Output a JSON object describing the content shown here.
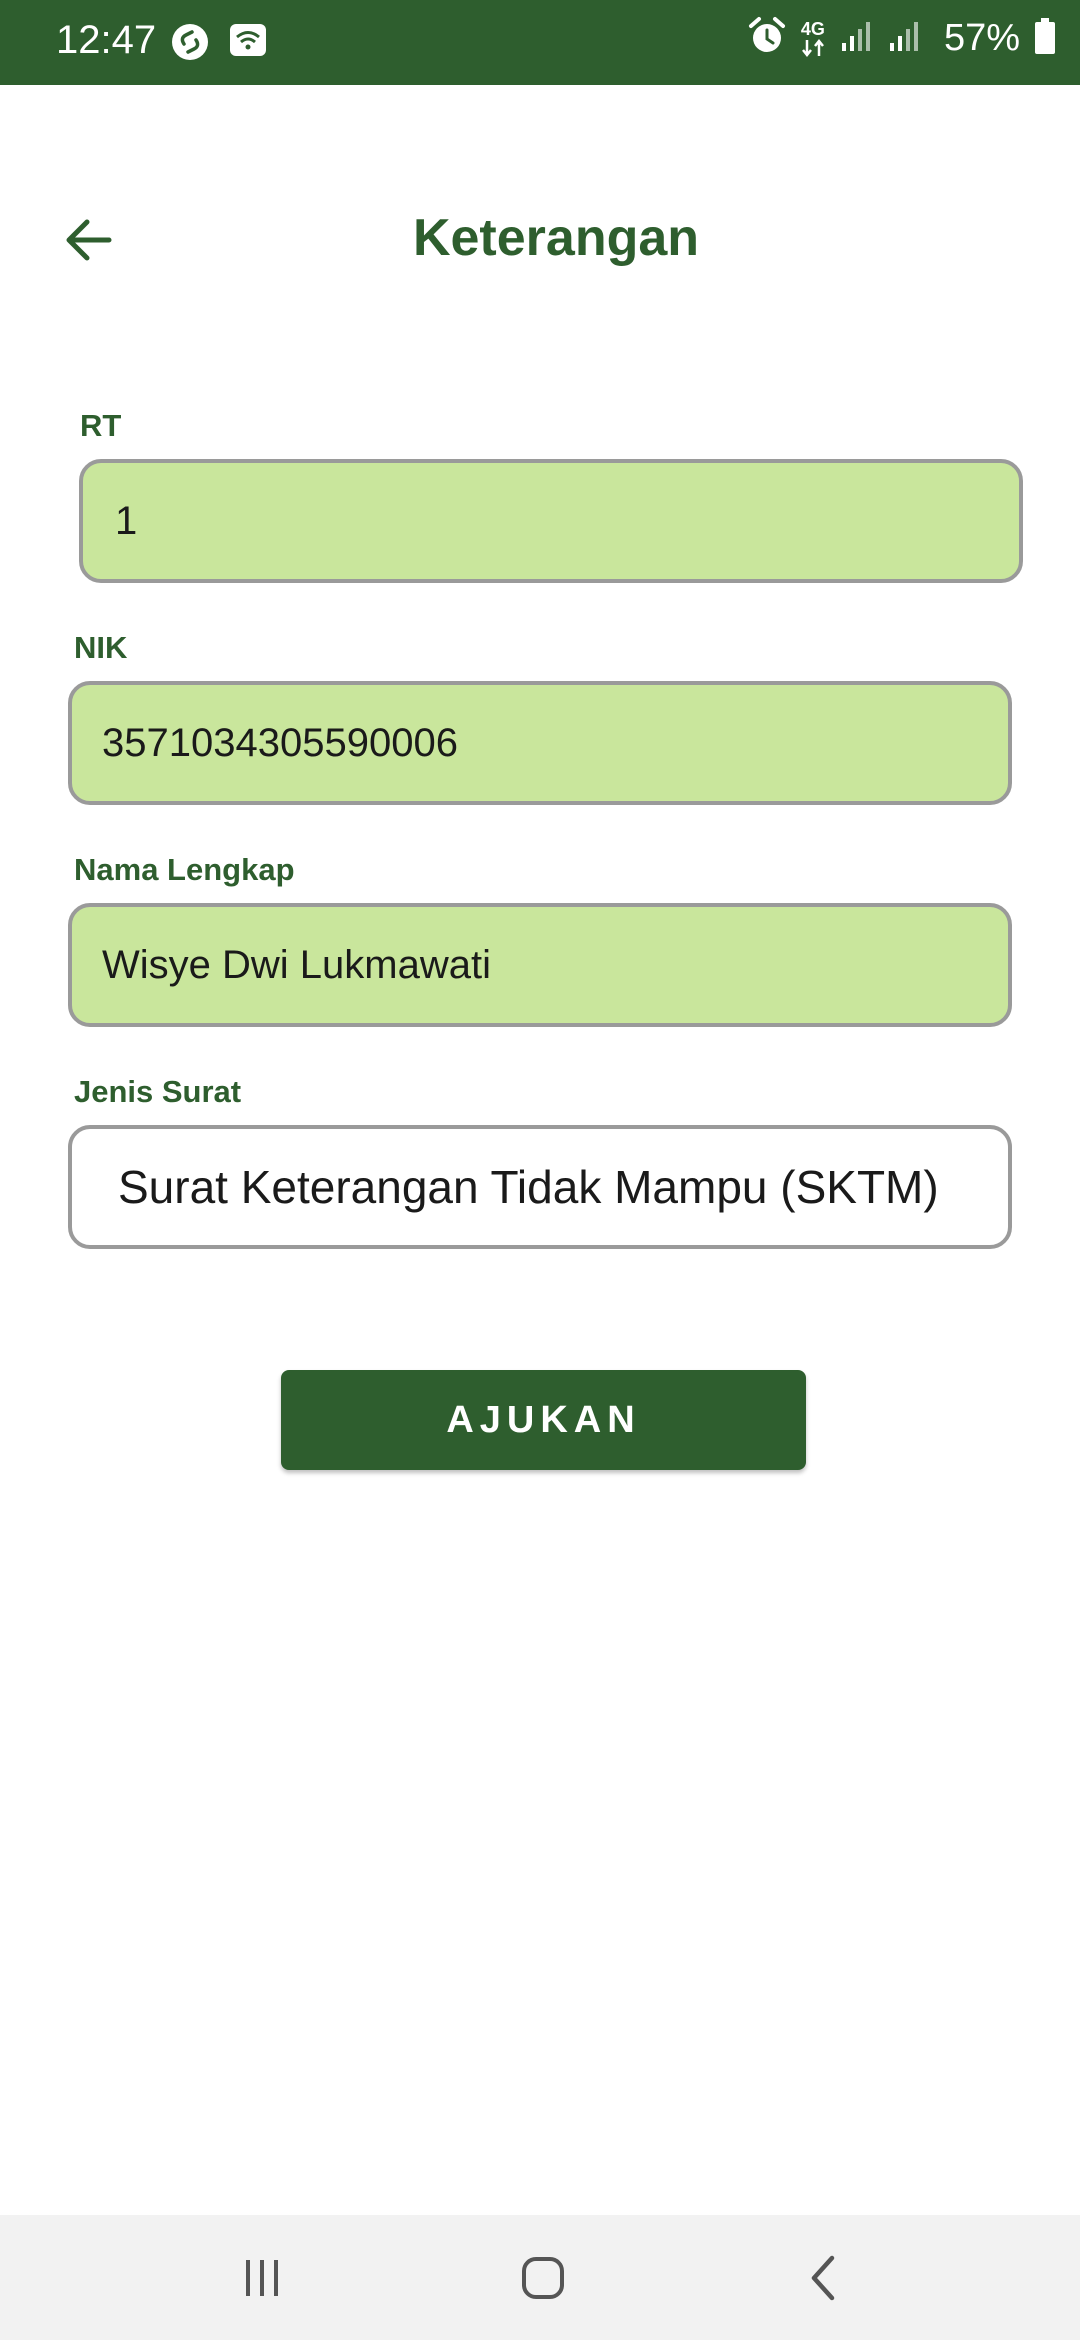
{
  "status_bar": {
    "time": "12:47",
    "battery_percent": "57%",
    "left_icons": [
      "shazam-icon",
      "wifi-icon"
    ],
    "right_icons": [
      "alarm-icon",
      "4g-data-icon",
      "signal-icon",
      "signal-icon",
      "battery-icon"
    ],
    "network_label": "4G"
  },
  "header": {
    "title": "Keterangan",
    "back_icon": "arrow-left-icon"
  },
  "form": {
    "rt": {
      "label": "RT",
      "value": "1"
    },
    "nik": {
      "label": "NIK",
      "value": "3571034305590006"
    },
    "nama": {
      "label": "Nama Lengkap",
      "value": "Wisye Dwi Lukmawati"
    },
    "jenis_surat": {
      "label": "Jenis Surat",
      "value": "Surat Keterangan Tidak Mampu (SKTM)"
    }
  },
  "submit_label": "AJUKAN",
  "nav_bar": {
    "items": [
      "recent-apps-icon",
      "home-icon",
      "back-icon"
    ]
  },
  "colors": {
    "primary": "#2e5e2e",
    "field_fill": "#c9e69c",
    "field_border": "#9a9a9a"
  }
}
